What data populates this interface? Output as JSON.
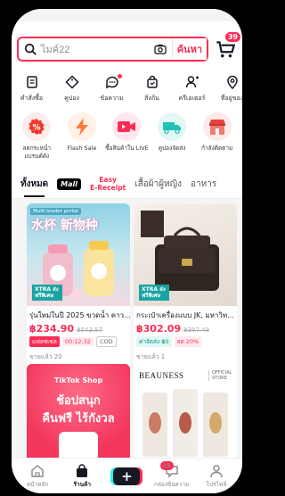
{
  "search": {
    "placeholder": "ไมค์22",
    "button_label": "ค้นหา",
    "cart_badge": "39"
  },
  "shortcuts": [
    {
      "label": "คำสั่งซื้อ",
      "icon": "orders-icon"
    },
    {
      "label": "คูปอง",
      "icon": "coupon-icon"
    },
    {
      "label": "ข้อความ",
      "icon": "message-icon"
    },
    {
      "label": "สิ่งถ้น",
      "icon": "bag-icon"
    },
    {
      "label": "ครีเอเตอร์",
      "icon": "creator-icon"
    },
    {
      "label": "ที่อยู่ของ",
      "icon": "location-icon"
    }
  ],
  "categories": [
    {
      "label": "ลดกระหน่ำแบรนด์ดัง",
      "icon": "discount-icon"
    },
    {
      "label": "Flash Sale",
      "icon": "flash-icon"
    },
    {
      "label": "ซื้อสินค้าใน LIVE",
      "icon": "live-icon"
    },
    {
      "label": "คูปองจัดส่ง",
      "icon": "shipping-coupon-icon"
    },
    {
      "label": "กำลังติดตาม",
      "icon": "store-icon"
    }
  ],
  "tabs": {
    "all": "ทั้งหมด",
    "mall": "Mall",
    "easy_line1": "Easy",
    "easy_line2": "E-Receipt",
    "women": "เสื้อผ้าผู้หญิง",
    "food": "อาหาร"
  },
  "products": [
    {
      "title": "รุ่นใหม่ในปี 2025 ขวดน้ำ คาว...",
      "price": "฿234.90",
      "old_price": "฿543.57",
      "tag1": "แฟลชเซล",
      "tag2": "00:12:32",
      "tag3": "COD",
      "sold": "ขายแล้ว 20",
      "image_text": "水杯 新物种",
      "image_subtext": "Multi-leader portal",
      "badge": "XTRA ส่งฟรีพิเศษ"
    },
    {
      "title": "กระเป๋าเครื่องแบบ JK, มหาวิท...",
      "price": "฿302.09",
      "old_price": "฿397.48",
      "tag1": "ค่าจัดส่ง ฿0",
      "tag2": "ลด 20%",
      "sold": "ขายแล้ว 1",
      "badge": "XTRA ส่งฟรีพิเศษ"
    },
    {
      "image_brand": "TikTok Shop",
      "image_line1": "ช้อปสนุก",
      "image_line2": "คืนฟรี ไร้กังวล"
    },
    {
      "brand": "BEAUNESS",
      "store_label": "OFFICIAL STORE"
    }
  ],
  "nav": {
    "home": "หน้าหลัก",
    "shop": "ร้านค้า",
    "inbox": "กล่องข้อความ",
    "inbox_badge": "15",
    "profile": "โปรไฟล์"
  },
  "colors": {
    "brand": "#fe2c55",
    "dark": "#161823",
    "teal": "#25f4ee"
  }
}
